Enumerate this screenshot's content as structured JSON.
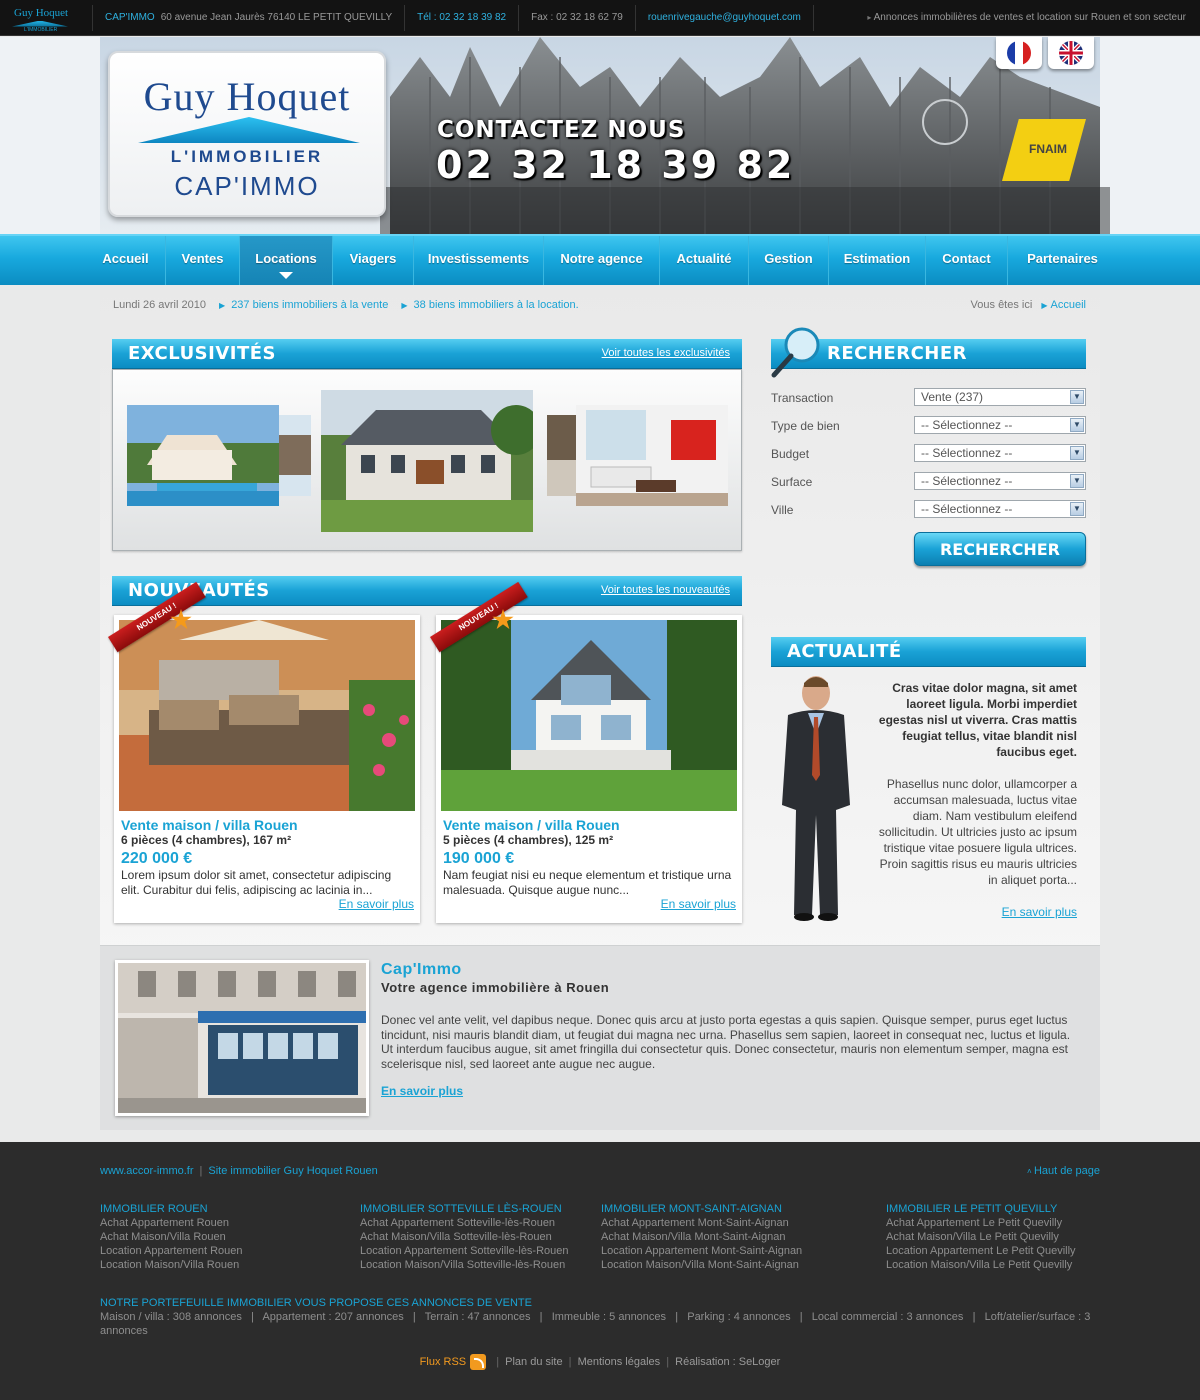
{
  "topbar": {
    "logo": "Guy Hoquet",
    "logo_sub": "L'IMMOBILIER",
    "agency": "CAP'IMMO",
    "address": "60 avenue Jean Jaurès 76140 LE PETIT QUEVILLY",
    "tel": "Tél : 02 32 18 39 82",
    "fax": "Fax : 02 32 18 62 79",
    "email": "rouenrivegauche@guyhoquet.com",
    "tagline": "Annonces immobilières de ventes et location sur Rouen et son secteur"
  },
  "header": {
    "logo_line1": "Guy Hoquet",
    "logo_line2": "L'IMMOBILIER",
    "logo_line3": "CAP'IMMO",
    "contact_title": "CONTACTEZ NOUS",
    "contact_phone": "02 32 18 39 82",
    "fnaim": "FNAIM"
  },
  "nav": {
    "items": [
      "Accueil",
      "Ventes",
      "Locations",
      "Viagers",
      "Investissements",
      "Notre agence",
      "Actualité",
      "Gestion",
      "Estimation",
      "Contact",
      "Partenaires"
    ],
    "active": "Locations"
  },
  "info": {
    "date": "Lundi 26 avril 2010",
    "sale_link": "237 biens immobiliers à la vente",
    "rent_link": "38 biens immobiliers à la location.",
    "you_are": "Vous êtes ici",
    "crumb_home": "Accueil"
  },
  "exclusivites": {
    "title": "EXCLUSIVITÉS",
    "link": "Voir toutes les exclusivités"
  },
  "nouveautes": {
    "title": "NOUVEAUTÉS",
    "link": "Voir toutes les nouveautés",
    "badge": "NOUVEAU !",
    "cards": [
      {
        "title": "Vente maison / villa Rouen",
        "details": "6 pièces (4 chambres), 167 m²",
        "price": "220 000 €",
        "desc": "Lorem ipsum dolor sit amet, consectetur adipiscing elit. Curabitur dui felis, adipiscing ac lacinia in...",
        "more": "En savoir plus"
      },
      {
        "title": "Vente maison / villa Rouen",
        "details": "5 pièces (4 chambres), 125 m²",
        "price": "190 000 €",
        "desc": "Nam feugiat nisi eu neque elementum et tristique urna malesuada. Quisque augue nunc...",
        "more": "En savoir plus"
      }
    ]
  },
  "search": {
    "title": "RECHERCHER",
    "fields": [
      {
        "label": "Transaction",
        "value": "Vente (237)"
      },
      {
        "label": "Type de bien",
        "value": "-- Sélectionnez --"
      },
      {
        "label": "Budget",
        "value": "-- Sélectionnez --"
      },
      {
        "label": "Surface",
        "value": "-- Sélectionnez --"
      },
      {
        "label": "Ville",
        "value": "-- Sélectionnez --"
      }
    ],
    "button": "RECHERCHER"
  },
  "actualite": {
    "title": "ACTUALITÉ",
    "bold": "Cras vitae dolor magna, sit amet laoreet ligula. Morbi imperdiet egestas nisl ut viverra. Cras mattis feugiat tellus, vitae blandit nisl faucibus eget.",
    "text": "Phasellus nunc dolor, ullamcorper a accumsan malesuada, luctus vitae diam. Nam vestibulum eleifend sollicitudin. Ut ultricies justo ac ipsum tristique vitae posuere ligula ultrices. Proin sagittis risus eu mauris ultricies in aliquet porta...",
    "more": "En savoir plus"
  },
  "agency": {
    "title": "Cap'Immo",
    "subtitle": "Votre agence immobilière à Rouen",
    "desc": "Donec vel ante velit, vel dapibus neque. Donec quis arcu at justo porta egestas a quis sapien. Quisque semper, purus eget luctus tincidunt, nisi mauris blandit diam, ut feugiat dui magna nec urna. Phasellus sem sapien, laoreet in consequat nec, luctus et ligula. Ut interdum faucibus augue, sit amet fringilla dui consectetur quis. Donec consectetur, mauris non elementum semper, magna est scelerisque nisl, sed laoreet ante augue nec augue.",
    "more": "En savoir plus"
  },
  "footer": {
    "site": "www.accor-immo.fr",
    "site_desc": "Site immobilier Guy Hoquet Rouen",
    "top": "Haut de page",
    "columns": [
      {
        "title": "IMMOBILIER ROUEN",
        "links": [
          "Achat Appartement Rouen",
          "Achat Maison/Villa Rouen",
          "Location Appartement Rouen",
          "Location Maison/Villa Rouen"
        ]
      },
      {
        "title": "IMMOBILIER SOTTEVILLE LÈS-ROUEN",
        "links": [
          "Achat Appartement Sotteville-lès-Rouen",
          "Achat Maison/Villa Sotteville-lès-Rouen",
          "Location Appartement Sotteville-lès-Rouen",
          "Location Maison/Villa Sotteville-lès-Rouen"
        ]
      },
      {
        "title": "IMMOBILIER MONT-SAINT-AIGNAN",
        "links": [
          "Achat Appartement Mont-Saint-Aignan",
          "Achat Maison/Villa Mont-Saint-Aignan",
          "Location Appartement Mont-Saint-Aignan",
          "Location Maison/Villa Mont-Saint-Aignan"
        ]
      },
      {
        "title": "IMMOBILIER LE PETIT QUEVILLY",
        "links": [
          "Achat Appartement Le Petit Quevilly",
          "Achat Maison/Villa Le Petit Quevilly",
          "Location Appartement Le Petit Quevilly",
          "Location Maison/Villa Le Petit Quevilly"
        ]
      }
    ],
    "portfolio_title": "NOTRE PORTEFEUILLE IMMOBILIER VOUS PROPOSE CES ANNONCES DE VENTE",
    "portfolio": "Maison / villa : 308 annonces   |   Appartement : 207 annonces   |   Terrain : 47 annonces   |   Immeuble : 5 annonces   |   Parking : 4 annonces   |   Local commercial : 3 annonces   |   Loft/atelier/surface : 3 annonces",
    "rss": "Flux RSS",
    "sitemap": "Plan du site",
    "legal": "Mentions légales",
    "credit": "Réalisation : SeLoger"
  },
  "colors": {
    "accent": "#1aa3d4",
    "nav": "#18a9de",
    "footer": "#2c2c2c"
  }
}
